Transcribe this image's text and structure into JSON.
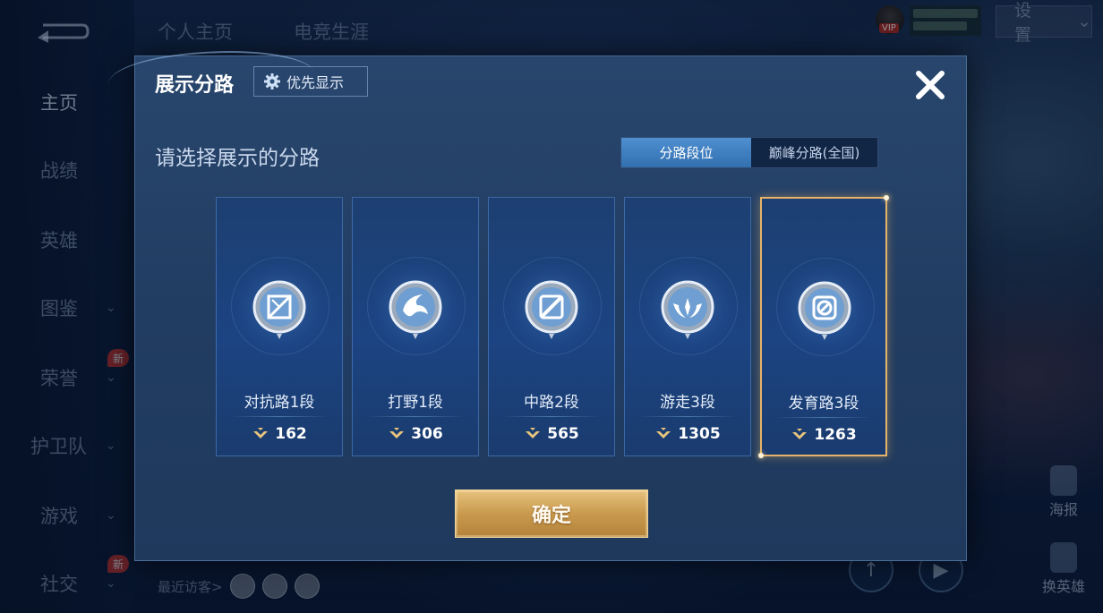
{
  "background": {
    "top_tabs": [
      "个人主页",
      "电竞生涯"
    ],
    "nav": [
      {
        "label": "主页",
        "chevron": false,
        "active": true
      },
      {
        "label": "战绩",
        "chevron": false
      },
      {
        "label": "英雄",
        "chevron": false
      },
      {
        "label": "图鉴",
        "chevron": true
      },
      {
        "label": "荣誉",
        "chevron": true,
        "badge": "新"
      },
      {
        "label": "护卫队",
        "chevron": true
      },
      {
        "label": "游戏",
        "chevron": true
      },
      {
        "label": "社交",
        "chevron": true,
        "badge": "新"
      }
    ],
    "settings_label": "设置",
    "vip_label": "VIP",
    "side_buttons": [
      "海报",
      "换英雄"
    ],
    "recent_visitors_label": "最近访客>"
  },
  "modal": {
    "title": "展示分路",
    "priority_button": "优先显示",
    "subtitle": "请选择展示的分路",
    "toggle": {
      "options": [
        "分路段位",
        "巅峰分路(全国)"
      ],
      "active_index": 0
    },
    "lanes": [
      {
        "name": "对抗路1段",
        "score": "162",
        "selected": false,
        "icon": "clash-lane-emblem-icon"
      },
      {
        "name": "打野1段",
        "score": "306",
        "selected": false,
        "icon": "jungle-emblem-icon"
      },
      {
        "name": "中路2段",
        "score": "565",
        "selected": false,
        "icon": "mid-lane-emblem-icon"
      },
      {
        "name": "游走3段",
        "score": "1305",
        "selected": false,
        "icon": "roam-emblem-icon"
      },
      {
        "name": "发育路3段",
        "score": "1263",
        "selected": true,
        "icon": "farm-lane-emblem-icon"
      }
    ],
    "confirm_button": "确定"
  },
  "colors": {
    "selected_border": "#e6b36a",
    "toggle_active": "#4f8fcf",
    "confirm_gold": "#c99a4e"
  }
}
